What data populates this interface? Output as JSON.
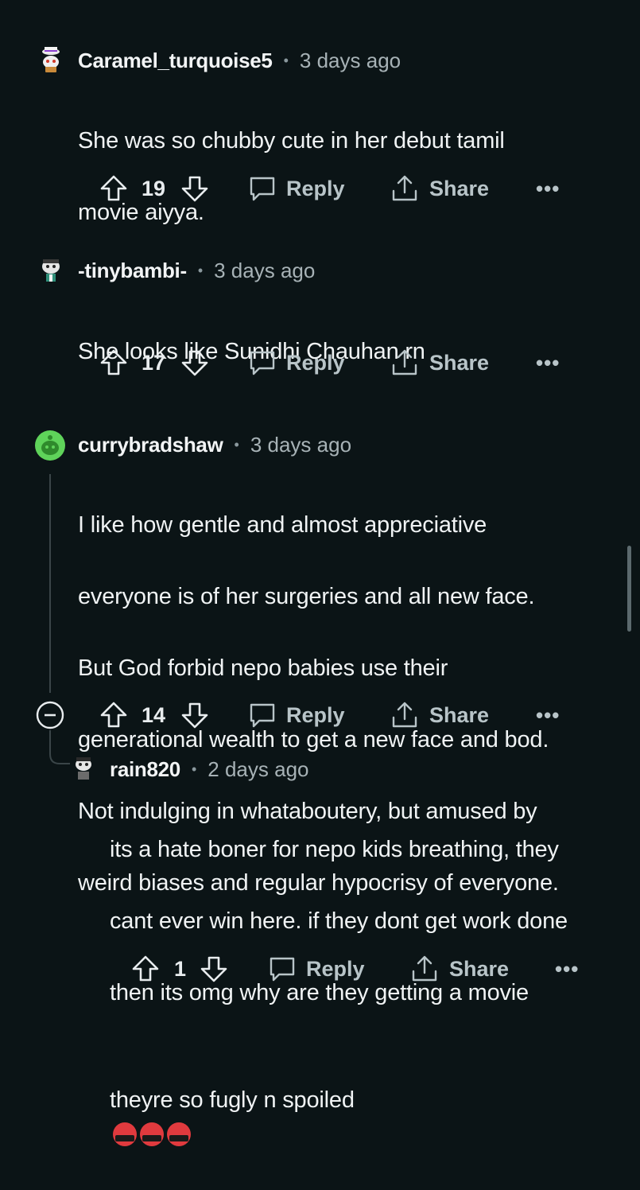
{
  "comments": [
    {
      "username": "Caramel_turquoise5",
      "time": "3 days ago",
      "lines": [
        "She was so chubby cute in her debut tamil",
        "movie aiyya."
      ],
      "votes": "19",
      "reply_label": "Reply",
      "share_label": "Share",
      "more_label": "•••"
    },
    {
      "username": "-tinybambi-",
      "time": "3 days ago",
      "lines": [
        "She looks like Sunidhi Chauhan rn"
      ],
      "votes": "17",
      "reply_label": "Reply",
      "share_label": "Share",
      "more_label": "•••"
    },
    {
      "username": "currybradshaw",
      "time": "3 days ago",
      "lines": [
        "I like how gentle and almost appreciative",
        "everyone is of her surgeries and all new face.",
        "But God forbid nepo babies use their",
        "generational wealth to get a new face and bod.",
        "Not indulging in whataboutery, but amused by",
        "weird biases and regular hypocrisy of everyone."
      ],
      "votes": "14",
      "reply_label": "Reply",
      "share_label": "Share",
      "more_label": "•••",
      "collapse_label": "−"
    },
    {
      "username": "rain820",
      "time": "2 days ago",
      "lines": [
        "its a hate boner for nepo kids breathing, they",
        "cant ever win here. if they dont get work done",
        "then its omg why are they getting a movie",
        "theyre so fugly n spoiled"
      ],
      "emoji_count": 3,
      "emoji_name": "face-with-symbols-on-mouth",
      "votes": "1",
      "reply_label": "Reply",
      "share_label": "Share",
      "more_label": "•••"
    }
  ],
  "dot": "•"
}
